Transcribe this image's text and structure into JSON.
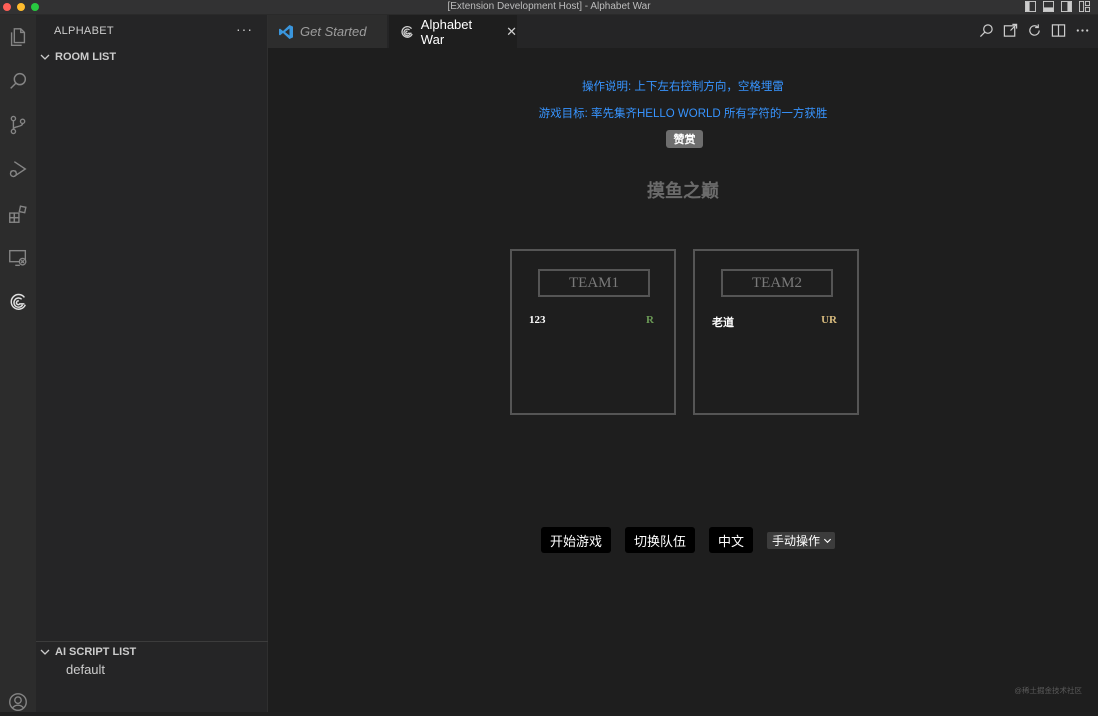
{
  "window": {
    "title": "[Extension Development Host] - Alphabet War"
  },
  "activity_bar": {
    "icons": [
      "files-icon",
      "search-icon",
      "source-control-icon",
      "run-debug-icon",
      "extensions-icon",
      "remote-explorer-icon",
      "alphabet-extension-icon",
      "account-icon"
    ]
  },
  "sidebar": {
    "header": "ALPHABET",
    "more_label": "···",
    "room_list_title": "ROOM LIST",
    "ai_script_list_title": "AI SCRIPT LIST",
    "ai_scripts": [
      "default"
    ]
  },
  "tabs": [
    {
      "label": "Get Started",
      "active": false
    },
    {
      "label": "Alphabet War",
      "active": true,
      "close": "✕"
    }
  ],
  "game": {
    "instruction": "操作说明: 上下左右控制方向，空格埋雷",
    "goal": "游戏目标: 率先集齐HELLO WORLD 所有字符的一方获胜",
    "reward_button": "赞赏",
    "title": "摸鱼之巅",
    "teams": [
      {
        "name": "TEAM1",
        "player": "123",
        "letters": "R",
        "letters_color": "#6a9955"
      },
      {
        "name": "TEAM2",
        "player": "老道",
        "letters": "UR",
        "letters_color": "#d7ba7d"
      }
    ],
    "buttons": {
      "start": "开始游戏",
      "switch_team": "切换队伍",
      "language": "中文"
    },
    "mode_select": {
      "selected": "手动操作"
    }
  },
  "watermark": "@稀土掘金技术社区",
  "colors": {
    "link_blue": "#3794ff",
    "editor_bg": "#1e1e1e",
    "sidebar_bg": "#252526",
    "activity_bg": "#2c2c2c"
  }
}
